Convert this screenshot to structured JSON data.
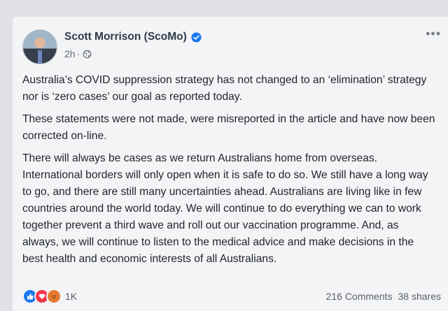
{
  "post": {
    "author": "Scott Morrison (ScoMo)",
    "time": "2h",
    "paragraphs": [
      "Australia’s COVID suppression strategy has not changed to an ‘elimination’ strategy nor is ‘zero cases’ our goal as reported today.",
      "These statements were not made, were misreported in the article and have now been corrected on-line.",
      "There will always be cases as we return Australians home from overseas. International borders will only open when it is safe to do so. We still have a long way to go, and there are still many uncertainties ahead. Australians are living like in few countries around the world today. We will continue to do everything we can to work together prevent a third wave and roll out our vaccination programme. And, as always, we will continue to listen to the medical advice and make decisions in the best health and economic interests of all Australians."
    ],
    "reactions": {
      "icons": [
        "like-icon",
        "love-icon",
        "angry-icon"
      ],
      "count": "1K"
    },
    "comments": "216 Comments",
    "shares": "38 shares"
  },
  "colors": {
    "like": "#1877f2",
    "love": "#f0344c",
    "angry": "#e57a2f",
    "verified": "#1877f2"
  }
}
